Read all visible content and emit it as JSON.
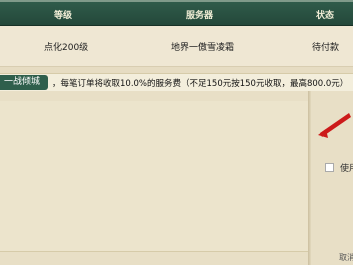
{
  "table": {
    "headers": {
      "level": "等级",
      "server": "服务器",
      "status": "状态"
    },
    "row": {
      "level": "点化200级",
      "server": "地界一傲雪凌霜",
      "status": "待付款"
    }
  },
  "notice": {
    "tag": "一战倾城",
    "text": "，每笔订单将收取10.0%的服务费（不足150元按150元收取，最高800.0元）"
  },
  "side": {
    "use_label": "使用",
    "cancel_label": "取消"
  },
  "colors": {
    "header_bg": "#2f5b4a",
    "tag_bg": "#2f5f4c",
    "arrow": "#cc1a1a"
  }
}
